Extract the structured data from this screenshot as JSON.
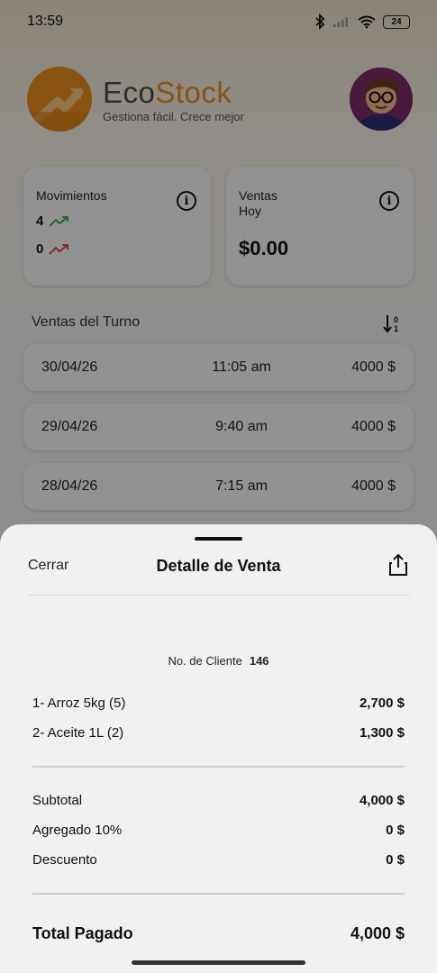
{
  "status_bar": {
    "time": "13:59",
    "battery": "24"
  },
  "header": {
    "brand_part1": "Eco",
    "brand_part2": "Stock",
    "tagline": "Gestiona fácil. Crece mejor"
  },
  "cards": {
    "movements": {
      "title": "Movimientos",
      "up_count": "4",
      "down_count": "0"
    },
    "sales_today": {
      "title_line1": "Ventas",
      "title_line2": "Hoy",
      "value": "$0.00"
    }
  },
  "shift_sales": {
    "label": "Ventas del Turno",
    "rows": [
      {
        "date": "30/04/26",
        "time": "11:05 am",
        "amount": "4000 $"
      },
      {
        "date": "29/04/26",
        "time": "9:40 am",
        "amount": "4000 $"
      },
      {
        "date": "28/04/26",
        "time": "7:15 am",
        "amount": "4000 $"
      }
    ]
  },
  "sheet": {
    "close_label": "Cerrar",
    "title": "Detalle de Venta",
    "client_label": "No. de Cliente",
    "client_number": "146",
    "items": [
      {
        "label": "1- Arroz 5kg (5)",
        "amount": "2,700 $"
      },
      {
        "label": "2- Aceite 1L (2)",
        "amount": "1,300 $"
      }
    ],
    "subtotal": {
      "label": "Subtotal",
      "amount": "4,000 $"
    },
    "surcharge": {
      "label": "Agregado 10%",
      "amount": "0 $"
    },
    "discount": {
      "label": "Descuento",
      "amount": "0 $"
    },
    "total": {
      "label": "Total Pagado",
      "amount": "4,000 $"
    }
  },
  "colors": {
    "brand_orange": "#e48a1d",
    "trend_up": "#2e9e4a",
    "trend_down": "#d93a3a"
  },
  "icons": [
    "bluetooth-icon",
    "signal-icon",
    "wifi-icon",
    "battery-icon",
    "info-icon",
    "trend-up-icon",
    "trend-down-icon",
    "sort-icon",
    "share-icon"
  ]
}
